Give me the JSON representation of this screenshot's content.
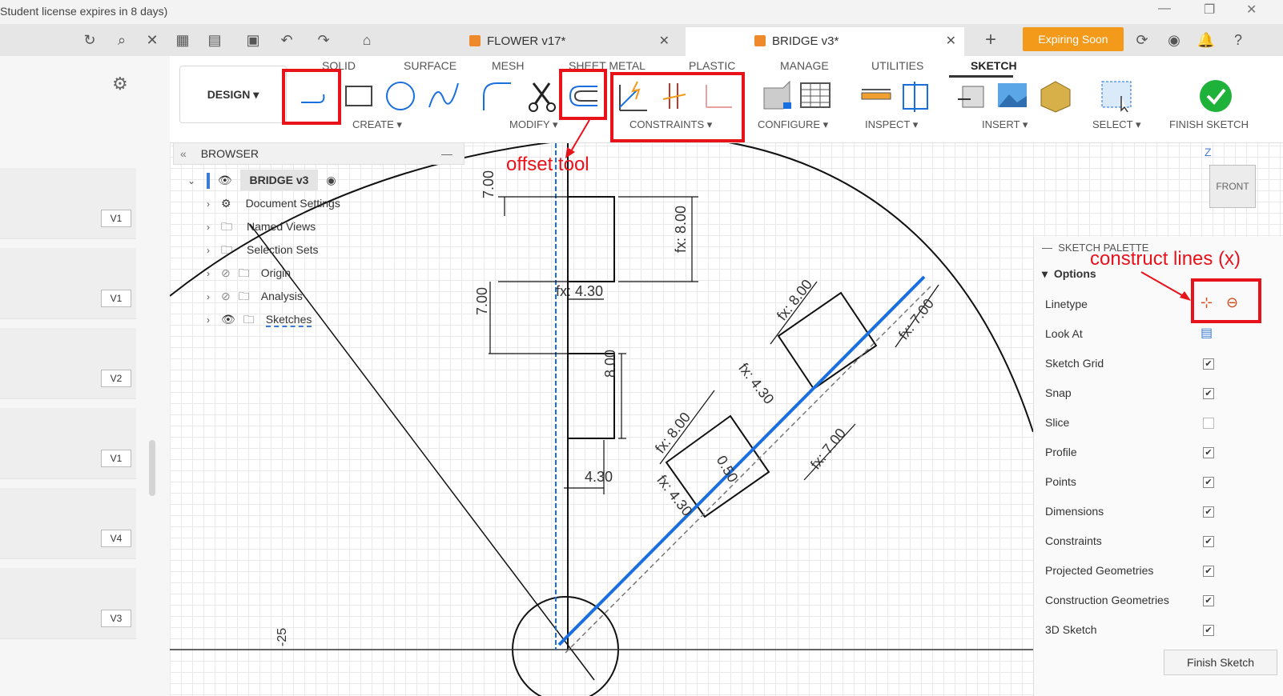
{
  "title_bar": {
    "license_notice": "Student license expires in 8 days)"
  },
  "tabs": {
    "flower": "FLOWER v17*",
    "bridge": "BRIDGE v3*",
    "new_tab": "+"
  },
  "expiring_badge": "Expiring Soon",
  "menu_tabs": [
    "SOLID",
    "SURFACE",
    "MESH",
    "SHEET METAL",
    "PLASTIC",
    "MANAGE",
    "UTILITIES",
    "SKETCH"
  ],
  "workspace": "DESIGN",
  "groups": {
    "create": "CREATE",
    "modify": "MODIFY",
    "constraints": "CONSTRAINTS",
    "configure": "CONFIGURE",
    "inspect": "INSPECT",
    "insert": "INSERT",
    "select": "SELECT",
    "finish": "FINISH SKETCH"
  },
  "browser": {
    "header": "BROWSER",
    "root": "BRIDGE v3",
    "items": [
      "Document Settings",
      "Named Views",
      "Selection Sets",
      "Origin",
      "Analysis",
      "Sketches"
    ]
  },
  "versions": [
    "V1",
    "V1",
    "V2",
    "V1",
    "V4",
    "V3"
  ],
  "viewcube": {
    "axis": "Z",
    "face": "FRONT"
  },
  "sketch_palette": {
    "header": "SKETCH PALETTE",
    "section": "Options",
    "rows": [
      {
        "label": "Linetype"
      },
      {
        "label": "Look At"
      },
      {
        "label": "Sketch Grid",
        "checked": true
      },
      {
        "label": "Snap",
        "checked": true
      },
      {
        "label": "Slice",
        "checked": false
      },
      {
        "label": "Profile",
        "checked": true
      },
      {
        "label": "Points",
        "checked": true
      },
      {
        "label": "Dimensions",
        "checked": true
      },
      {
        "label": "Constraints",
        "checked": true
      },
      {
        "label": "Projected Geometries",
        "checked": true
      },
      {
        "label": "Construction Geometries",
        "checked": true
      },
      {
        "label": "3D Sketch",
        "checked": true
      }
    ],
    "finish_button": "Finish Sketch"
  },
  "annotations": {
    "offset_tool": "offset tool",
    "construct_lines": "construct lines (x)"
  },
  "dimensions": {
    "d1": "7.00",
    "d2": "fx: 8.00",
    "d3": "fx: 4.30",
    "d4": "7.00",
    "d5": "8.00",
    "d6": "4.30",
    "d7": "fx: 8.00",
    "d8": "fx: 7.00",
    "d9": "fx: 4.30",
    "d10": "fx: 7.00",
    "d11": "fx: 8.00",
    "d12": "fx: 4.30",
    "d13": "0.50",
    "ruler_value": "-25"
  },
  "colors": {
    "accent_red": "#e8121b",
    "sketch_blue": "#1a6fe0",
    "expiring": "#f39a1b",
    "finish_green": "#1fb23a"
  }
}
